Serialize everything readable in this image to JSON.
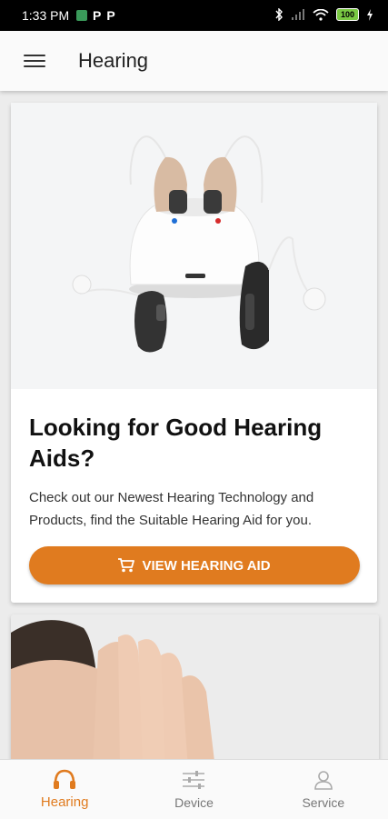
{
  "status_bar": {
    "time": "1:33 PM",
    "notification_icons": [
      "P",
      "P"
    ],
    "battery": "100"
  },
  "app_bar": {
    "title": "Hearing",
    "menu_icon": "hamburger-menu-icon"
  },
  "promo_card": {
    "heading": "Looking for Good Hearing Aids?",
    "body": "Check out our Newest Hearing Technology and Products, find the Suitable Hearing Aid for you.",
    "button_label": "VIEW HEARING AID",
    "button_icon": "shopping-cart-icon"
  },
  "bottom_nav": {
    "items": [
      {
        "label": "Hearing",
        "icon": "headphones-icon",
        "active": true
      },
      {
        "label": "Device",
        "icon": "sliders-icon",
        "active": false
      },
      {
        "label": "Service",
        "icon": "person-icon",
        "active": false
      }
    ]
  },
  "colors": {
    "accent": "#e07b1f",
    "app_bar_bg": "#fafafa"
  }
}
